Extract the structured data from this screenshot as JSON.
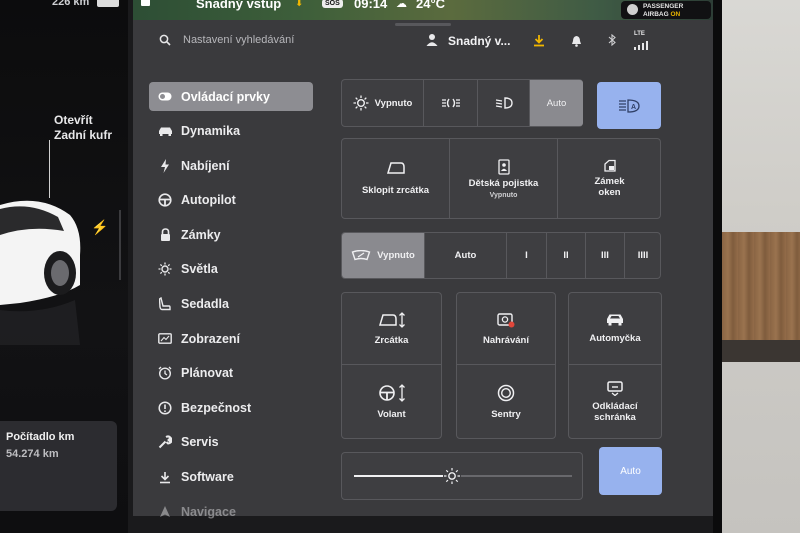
{
  "status_bar": {
    "range": "226 km",
    "profile": "Snadný vstup",
    "sos": "SOS",
    "time": "09:14",
    "temperature": "24°C",
    "airbag_line1": "PASSENGER",
    "airbag_line2": "AIRBAG",
    "airbag_state": "ON"
  },
  "car": {
    "trunk_line1": "Otevřít",
    "trunk_line2": "Zadní kufr",
    "odometer_title": "Počítadlo km",
    "odometer_value": "54.274 km"
  },
  "header": {
    "search_placeholder": "Nastavení vyhledávání",
    "user_name": "Snadný v...",
    "network": "LTE"
  },
  "sidebar": {
    "items": [
      {
        "label": "Ovládací prvky",
        "icon": "toggle-icon",
        "active": true
      },
      {
        "label": "Dynamika",
        "icon": "car-icon"
      },
      {
        "label": "Nabíjení",
        "icon": "bolt-icon"
      },
      {
        "label": "Autopilot",
        "icon": "steering-wheel-icon"
      },
      {
        "label": "Zámky",
        "icon": "lock-icon"
      },
      {
        "label": "Světla",
        "icon": "sun-icon"
      },
      {
        "label": "Sedadla",
        "icon": "seat-icon"
      },
      {
        "label": "Zobrazení",
        "icon": "display-icon"
      },
      {
        "label": "Plánovat",
        "icon": "alarm-clock-icon"
      },
      {
        "label": "Bezpečnost",
        "icon": "alert-circle-icon"
      },
      {
        "label": "Servis",
        "icon": "wrench-icon"
      },
      {
        "label": "Software",
        "icon": "download-icon"
      },
      {
        "label": "Navigace",
        "icon": "navigation-icon"
      }
    ]
  },
  "lights": {
    "off_label": "Vypnuto",
    "auto_label": "Auto",
    "selected": "Auto"
  },
  "quick": {
    "mirrors_fold": "Sklopit zrcátka",
    "child_lock": "Dětská pojistka",
    "child_lock_state": "Vypnuto",
    "window_lock_l1": "Zámek",
    "window_lock_l2": "oken"
  },
  "wipers": {
    "off_label": "Vypnuto",
    "auto_label": "Auto",
    "speeds": [
      "I",
      "II",
      "III",
      "IIII"
    ],
    "selected": "Vypnuto"
  },
  "tiles": {
    "mirrors": "Zrcátka",
    "recording": "Nahrávání",
    "car_wash": "Automyčka",
    "steering": "Volant",
    "sentry": "Sentry",
    "glovebox_l1": "Odkládací",
    "glovebox_l2": "schránka"
  },
  "brightness": {
    "level": 0.45,
    "auto_label": "Auto"
  },
  "colors": {
    "accent_blue": "#97b2ee",
    "selected_gray": "#8a8a8f",
    "panel": "#3a3a3d",
    "recording_red": "#e0463a",
    "download_yellow": "#f1b600"
  }
}
